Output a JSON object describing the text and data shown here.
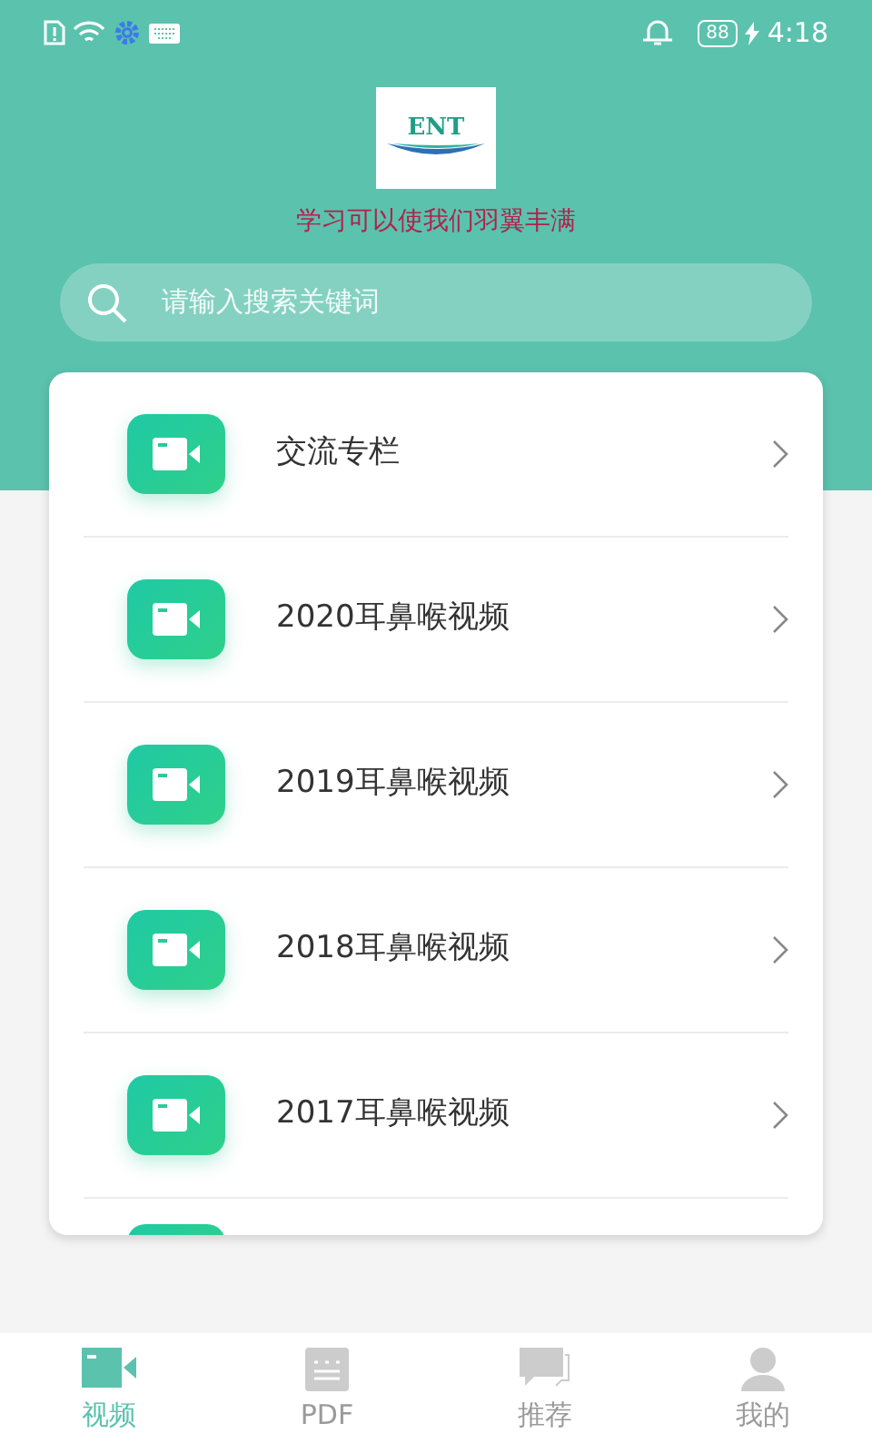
{
  "status_bar": {
    "battery": "88",
    "time": "4:18"
  },
  "header": {
    "tagline": "学习可以使我们羽翼丰满",
    "logo_text": "ENT"
  },
  "search": {
    "placeholder": "请输入搜索关键词"
  },
  "menu_items": [
    {
      "label": "交流专栏"
    },
    {
      "label": "2020耳鼻喉视频"
    },
    {
      "label": "2019耳鼻喉视频"
    },
    {
      "label": "2018耳鼻喉视频"
    },
    {
      "label": "2017耳鼻喉视频"
    }
  ],
  "bottom_nav": [
    {
      "label": "视频",
      "kind": "video",
      "selected": true
    },
    {
      "label": "PDF",
      "kind": "doc",
      "selected": false
    },
    {
      "label": "推荐",
      "kind": "chat",
      "selected": false
    },
    {
      "label": "我的",
      "kind": "user",
      "selected": false
    }
  ]
}
